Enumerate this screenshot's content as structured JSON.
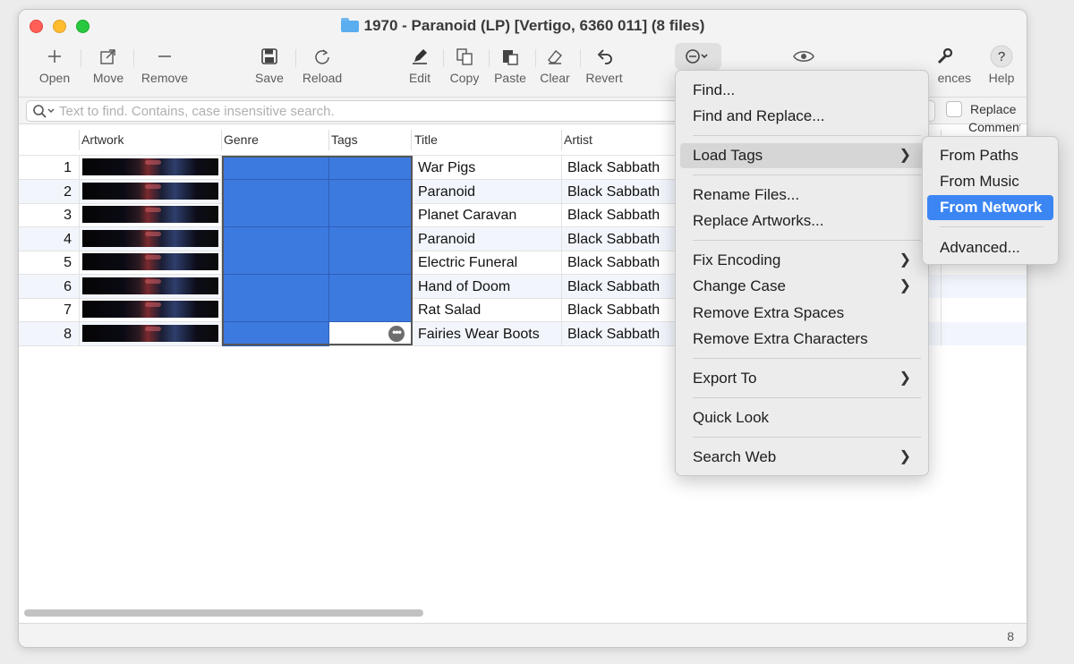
{
  "window": {
    "title": "1970 - Paranoid (LP) [Vertigo, 6360 011] (8 files)"
  },
  "toolbar": {
    "open": "Open",
    "move": "Move",
    "remove": "Remove",
    "save": "Save",
    "reload": "Reload",
    "edit": "Edit",
    "copy": "Copy",
    "paste": "Paste",
    "clear": "Clear",
    "revert": "Revert",
    "preferences_partial": "ences",
    "help": "Help"
  },
  "search": {
    "placeholder": "Text to find. Contains, case insensitive search.",
    "replace_label": "Replace"
  },
  "columns": {
    "artwork": "Artwork",
    "genre": "Genre",
    "tags": "Tags",
    "title": "Title",
    "artist": "Artist",
    "partial": "Comment"
  },
  "rows": [
    {
      "n": "1",
      "title": "War Pigs",
      "artist": "Black Sabbath"
    },
    {
      "n": "2",
      "title": "Paranoid",
      "artist": "Black Sabbath"
    },
    {
      "n": "3",
      "title": "Planet Caravan",
      "artist": "Black Sabbath"
    },
    {
      "n": "4",
      "title": "Paranoid",
      "artist": "Black Sabbath"
    },
    {
      "n": "5",
      "title": "Electric Funeral",
      "artist": "Black Sabbath"
    },
    {
      "n": "6",
      "title": "Hand of Doom",
      "artist": "Black Sabbath"
    },
    {
      "n": "7",
      "title": "Rat Salad",
      "artist": "Black Sabbath"
    },
    {
      "n": "8",
      "title": "Fairies Wear Boots",
      "artist": "Black Sabbath"
    }
  ],
  "menu": {
    "find": "Find...",
    "find_replace": "Find and Replace...",
    "load_tags": "Load Tags",
    "rename_files": "Rename Files...",
    "replace_artworks": "Replace Artworks...",
    "fix_encoding": "Fix Encoding",
    "change_case": "Change Case",
    "remove_spaces": "Remove Extra Spaces",
    "remove_chars": "Remove Extra Characters",
    "export_to": "Export To",
    "quick_look": "Quick Look",
    "search_web": "Search Web"
  },
  "submenu": {
    "from_paths": "From Paths",
    "from_music": "From Music",
    "from_network": "From Network",
    "advanced": "Advanced..."
  },
  "status": {
    "count": "8"
  },
  "colors": {
    "selection": "#3d7ae0",
    "menu_highlight": "#3c86f4"
  }
}
